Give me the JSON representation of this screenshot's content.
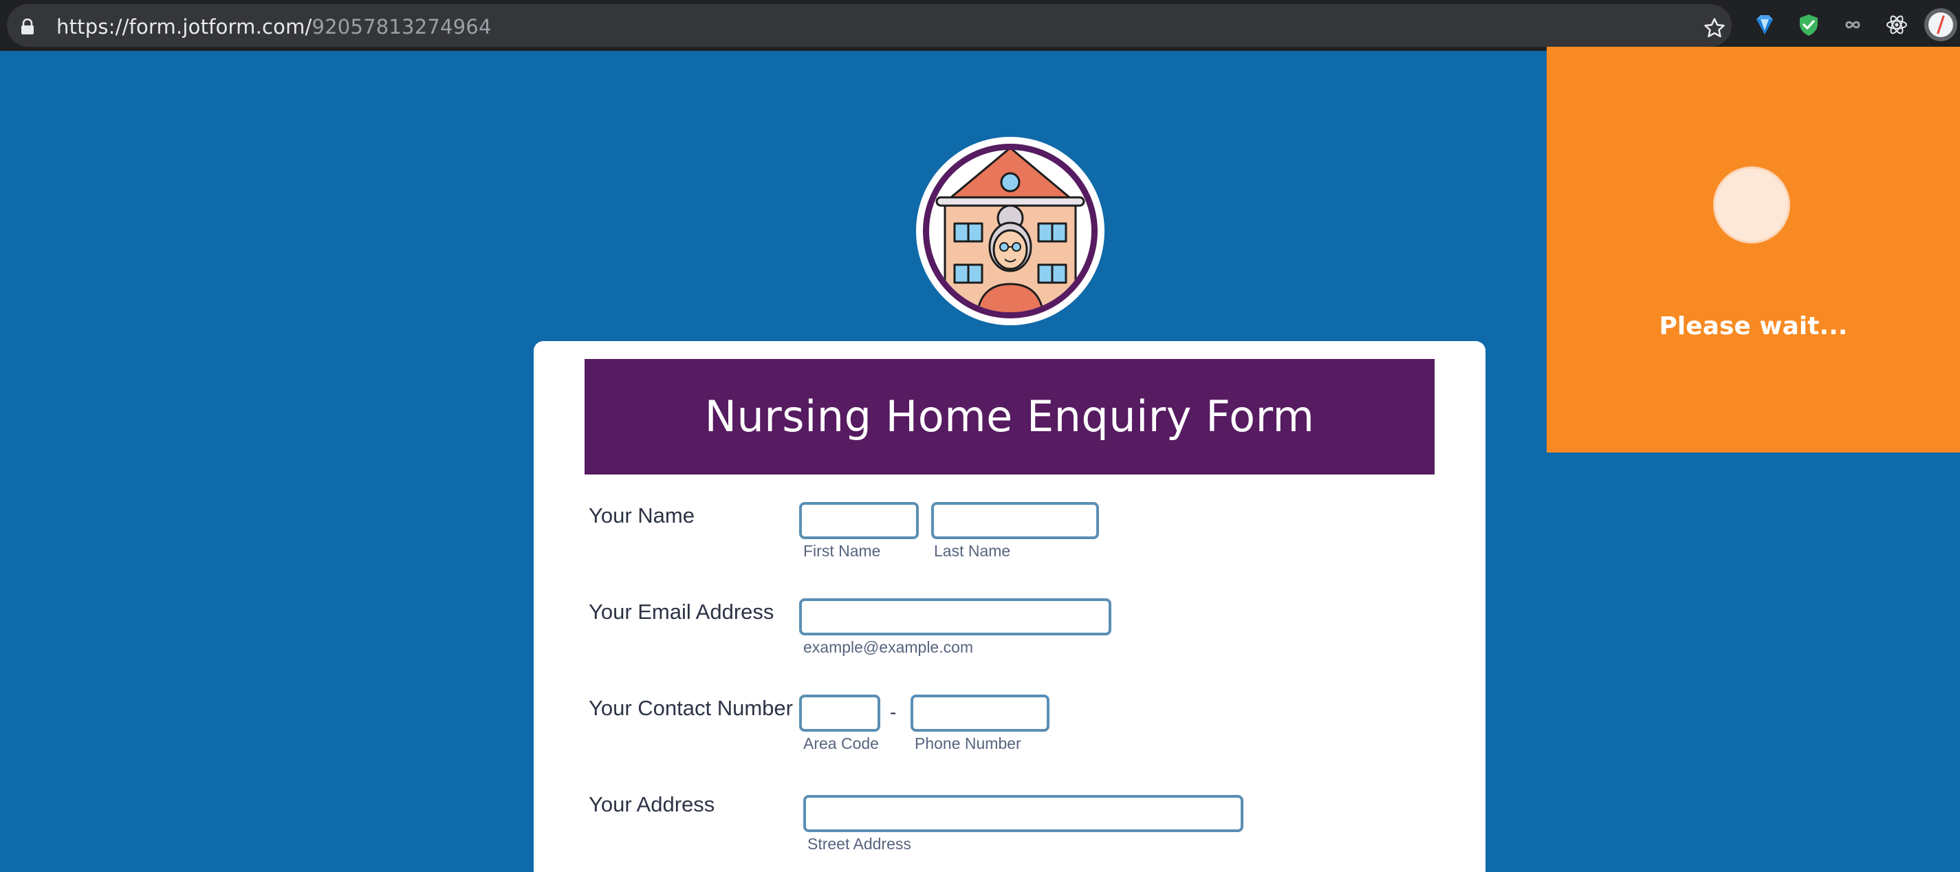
{
  "browser": {
    "url_host": "https://form.jotform.com/",
    "url_path": "92057813274964"
  },
  "form": {
    "title": "Nursing Home Enquiry Form",
    "fields": {
      "name": {
        "label": "Your Name",
        "first_sub": "First Name",
        "last_sub": "Last Name"
      },
      "email": {
        "label": "Your Email Address",
        "sub": "example@example.com"
      },
      "phone": {
        "label": "Your Contact Number",
        "area_sub": "Area Code",
        "separator": "-",
        "number_sub": "Phone Number"
      },
      "address": {
        "label": "Your Address",
        "sub": "Street Address"
      }
    }
  },
  "overlay": {
    "message": "Please wait..."
  },
  "colors": {
    "page_bg": "#0f6aaa",
    "header_band": "#561b60",
    "overlay": "#f88a23",
    "input_border": "#5a8fb4"
  },
  "icons": [
    "lock-icon",
    "bookmark-star-icon",
    "gem-extension-icon",
    "shield-extension-icon",
    "infinity-extension-icon",
    "react-extension-icon",
    "profile-avatar",
    "nursing-home-logo"
  ]
}
